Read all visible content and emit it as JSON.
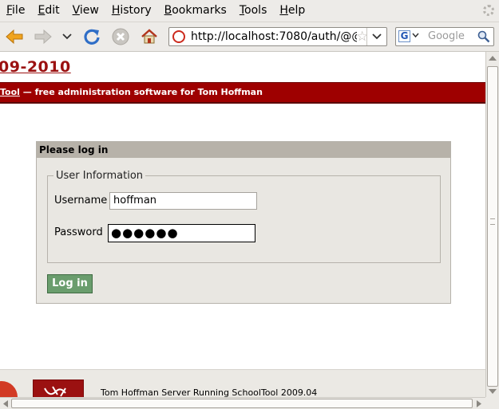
{
  "menu": [
    {
      "label": "File"
    },
    {
      "label": "Edit"
    },
    {
      "label": "View"
    },
    {
      "label": "History"
    },
    {
      "label": "Bookmarks"
    },
    {
      "label": "Tools"
    },
    {
      "label": "Help"
    }
  ],
  "toolbar": {
    "back_icon": "back-arrow-icon",
    "forward_icon": "forward-arrow-icon",
    "reload_icon": "reload-icon",
    "stop_icon": "stop-icon",
    "home_icon": "home-icon"
  },
  "address_bar": {
    "url": "http://localhost:7080/auth/@@"
  },
  "search_bar": {
    "engine_letter": "G",
    "placeholder": "Google"
  },
  "page": {
    "site_title": "09-2010",
    "banner_link": "Tool",
    "banner_text": " — free administration software for Tom Hoffman",
    "login": {
      "header": "Please log in",
      "fieldset_legend": "User Information",
      "username_label": "Username",
      "username_value": "hoffman",
      "password_label": "Password",
      "password_mask": "●●●●●●",
      "submit_label": "Log in"
    },
    "footer_text": "Tom Hoffman Server Running SchoolTool 2009.04"
  },
  "colors": {
    "brand_red": "#9e0000",
    "login_button": "#6a9d6d"
  }
}
